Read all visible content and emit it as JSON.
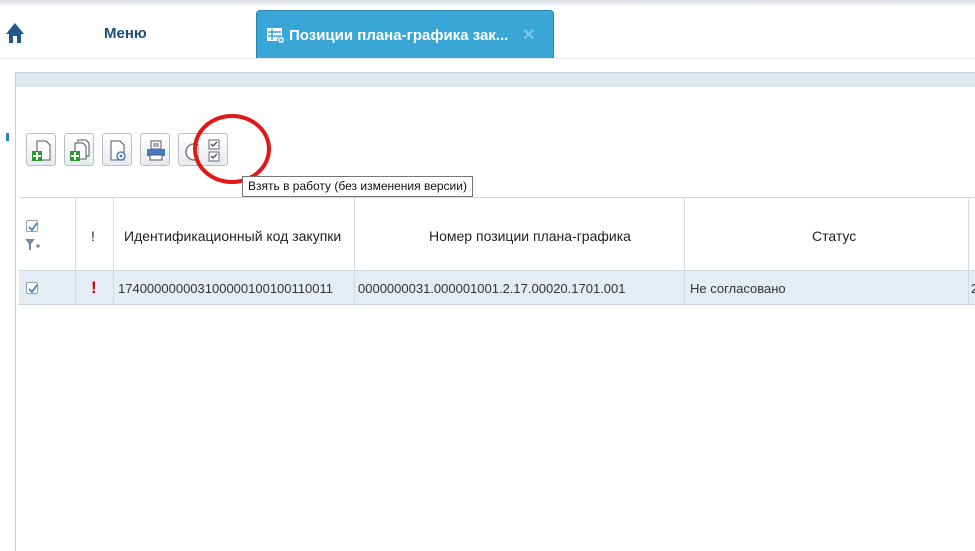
{
  "top_nav": {
    "home_icon": "home-icon",
    "menu_label": "Меню",
    "active_tab_label": "Позиции плана-графика зак...",
    "active_tab_icon": "table-icon",
    "close_icon": "close-icon",
    "active_tab_color": "#3aa6d8"
  },
  "toolbar": {
    "buttons": [
      {
        "name": "add-icon"
      },
      {
        "name": "copy-add-icon"
      },
      {
        "name": "document-view-icon"
      },
      {
        "name": "print-icon"
      },
      {
        "name": "circle-icon"
      },
      {
        "name": "take-to-work-icon"
      }
    ],
    "tooltip": "Взять в работу  (без изменения версии)",
    "highlight_color": "#e01818"
  },
  "grid": {
    "columns": [
      {
        "label": ""
      },
      {
        "label": "!"
      },
      {
        "label": "Идентификационный код закупки"
      },
      {
        "label": "Номер позиции плана-графика"
      },
      {
        "label": "Статус"
      }
    ],
    "rows": [
      {
        "checked": true,
        "flag": "!",
        "code": "174000000003100000100100110011",
        "position_number": "0000000031.000001001.2.17.00020.1701.001",
        "status": "Не согласовано",
        "extra": "2"
      }
    ],
    "row_color": "#e4ecf4",
    "flag_color": "#d40000"
  }
}
